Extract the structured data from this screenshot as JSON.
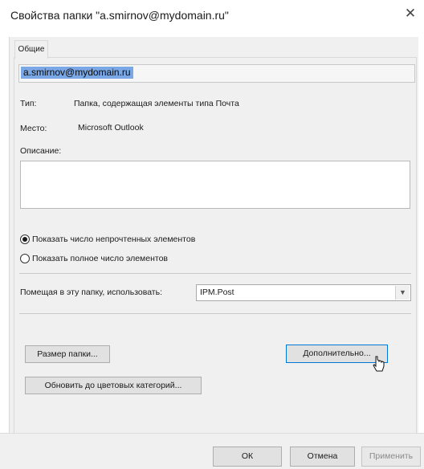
{
  "window": {
    "title": "Свойства папки \"a.smirnov@mydomain.ru\"",
    "close_glyph": "✕"
  },
  "tabs": [
    {
      "label": "Общие",
      "selected": true
    }
  ],
  "general": {
    "folder_name": "a.smirnov@mydomain.ru",
    "type_label": "Тип:",
    "type_value": "Папка, содержащая элементы типа Почта",
    "location_label": "Место:",
    "location_value": "Microsoft Outlook",
    "description_label": "Описание:",
    "description_value": "",
    "radio_unread_label": "Показать число непрочтенных элементов",
    "radio_total_label": "Показать полное число элементов",
    "radio_selected": "unread",
    "post_form_label": "Помещая в эту папку, использовать:",
    "post_form_value": "IPM.Post",
    "folder_size_button": "Размер папки...",
    "advanced_button": "Дополнительно...",
    "upgrade_categories_button": "Обновить до цветовых категорий..."
  },
  "footer": {
    "ok": "ОК",
    "cancel": "Отмена",
    "apply": "Применить"
  },
  "colors": {
    "selection": "#7aa7e6",
    "focus": "#0078d7",
    "dialog_bg": "#f0f0f0"
  }
}
